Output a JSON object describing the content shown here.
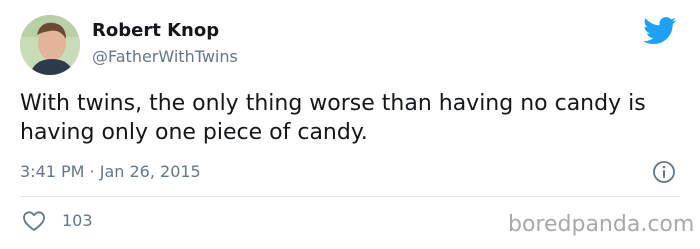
{
  "author": {
    "display_name": "Robert Knop",
    "handle": "@FatherWithTwins"
  },
  "tweet": {
    "text": "With twins, the only thing worse than having no candy is having only one piece of candy.",
    "timestamp": "3:41 PM · Jan 26, 2015",
    "likes": "103"
  },
  "watermark": "boredpanda.com",
  "icons": {
    "brand": "twitter-bird-icon",
    "info": "info-icon",
    "like": "heart-icon"
  },
  "colors": {
    "twitter_blue": "#1da1f2",
    "secondary_text": "#657786",
    "primary_text": "#14171a"
  }
}
